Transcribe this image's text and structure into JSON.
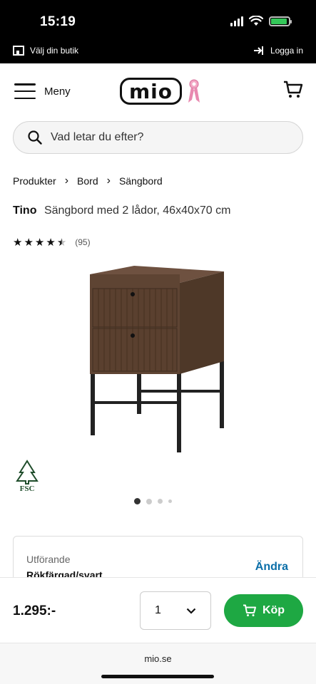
{
  "status_bar": {
    "time": "15:19"
  },
  "topbar": {
    "store_label": "Välj din butik",
    "login_label": "Logga in"
  },
  "header": {
    "menu_label": "Meny",
    "logo_text": "mio"
  },
  "search": {
    "placeholder": "Vad letar du efter?"
  },
  "breadcrumb": [
    "Produkter",
    "Bord",
    "Sängbord"
  ],
  "product": {
    "name": "Tino",
    "description": "Sängbord med 2 lådor, 46x40x70 cm",
    "rating_value": 4.5,
    "rating_max": 5,
    "review_count": "(95)",
    "certification": "FSC",
    "image_index": 0,
    "image_count": 4
  },
  "variant": {
    "label": "Utförande",
    "value": "Rökfärgad/svart",
    "change_label": "Ändra"
  },
  "purchase": {
    "price": "1.295:-",
    "quantity": "1",
    "buy_label": "Köp"
  },
  "browser": {
    "url": "mio.se"
  },
  "colors": {
    "buy_green": "#1ea843",
    "link_blue": "#0a6ea8",
    "wood": "#5a4030"
  }
}
